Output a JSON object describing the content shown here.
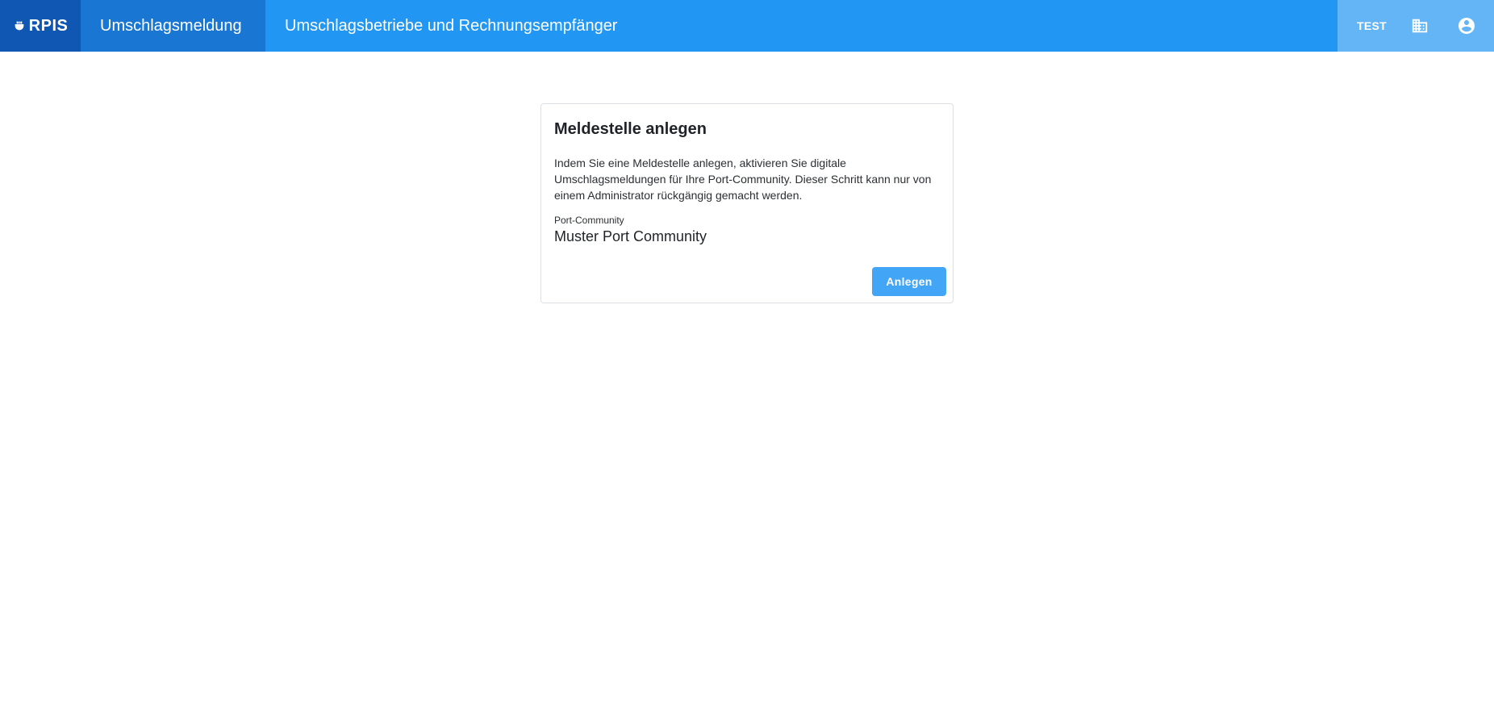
{
  "header": {
    "logo_text": "RPIS",
    "tabs": [
      {
        "label": "Umschlagsmeldung",
        "active": true
      },
      {
        "label": "Umschlagsbetriebe und Rechnungsempfänger",
        "active": false
      }
    ],
    "environment": "TEST",
    "icons": [
      "ship-icon",
      "building-icon",
      "account-circle-icon"
    ]
  },
  "card": {
    "title": "Meldestelle anlegen",
    "description": "Indem Sie eine Meldestelle anlegen, aktivieren Sie digitale Umschlagsmeldungen für Ihre Port-Community. Dieser Schritt kann nur von einem Administrator rückgängig gemacht werden.",
    "field_label": "Port-Community",
    "field_value": "Muster Port Community",
    "button_label": "Anlegen"
  },
  "colors": {
    "header_bg": "#2196f3",
    "logo_bg": "#0f57b2",
    "active_tab_bg": "#1976d2",
    "right_area_bg": "#64b5f6",
    "button_bg": "#42a5f5"
  }
}
